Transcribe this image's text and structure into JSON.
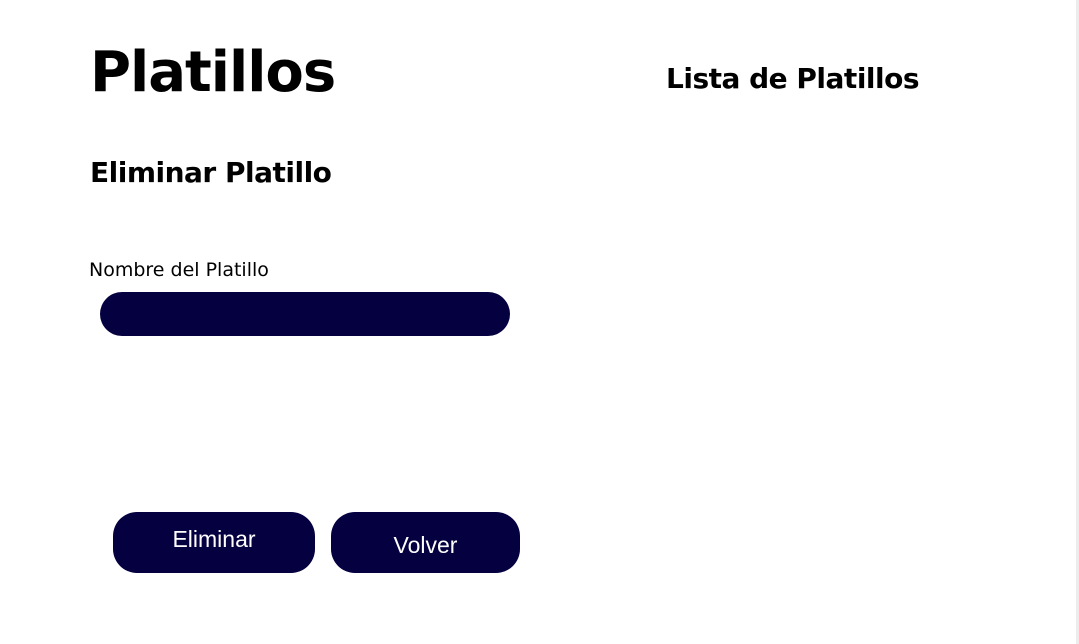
{
  "header": {
    "title": "Platillos",
    "list_title": "Lista de Platillos"
  },
  "form": {
    "section_title": "Eliminar Platillo",
    "name_label": "Nombre del Platillo",
    "name_value": "",
    "delete_label": "Eliminar",
    "back_label": "Volver"
  },
  "colors": {
    "accent": "#050040",
    "background": "#ffffff",
    "text": "#000000"
  }
}
